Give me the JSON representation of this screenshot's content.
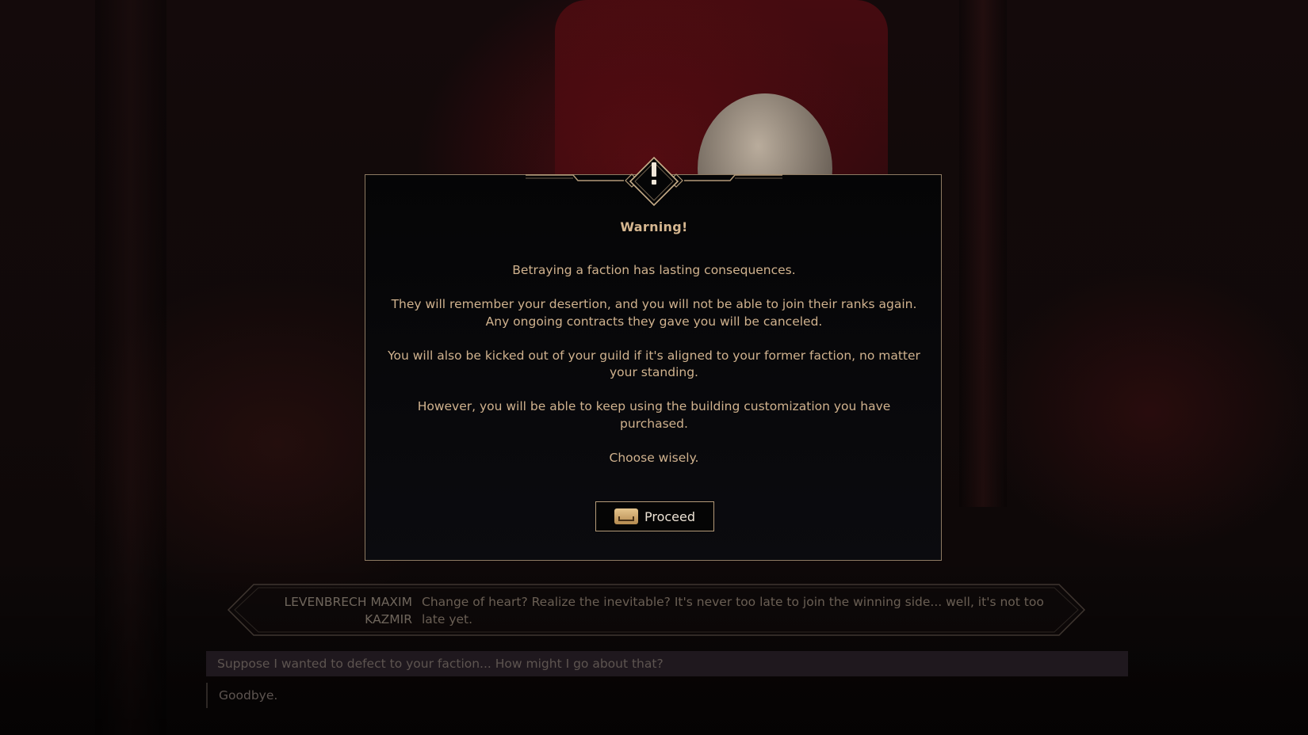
{
  "dialog": {
    "icon": "exclamation-icon",
    "title": "Warning!",
    "paragraphs": [
      "Betraying a faction has lasting consequences.",
      "They will remember your desertion, and you will not be able to join their ranks again. Any ongoing contracts they gave you will be canceled.",
      "You will also be kicked out of your guild if it's aligned to your former faction, no matter your standing.",
      "However, you will be able to keep using the building customization you have purchased.",
      "Choose wisely."
    ],
    "proceed_button": {
      "label": "Proceed",
      "key_icon": "space-key-icon"
    }
  },
  "conversation": {
    "speaker": "LEVENBRECH MAXIM KAZMIR",
    "line": "Change of heart? Realize the inevitable? It's never too late to join the winning side... well, it's not too late yet.",
    "replies": [
      "Suppose I wanted to defect to your faction... How might I go about that?",
      "Goodbye."
    ]
  },
  "colors": {
    "accent_gold": "#d6b790",
    "border": "#8d7a62",
    "panel_bg": "#08080b"
  }
}
